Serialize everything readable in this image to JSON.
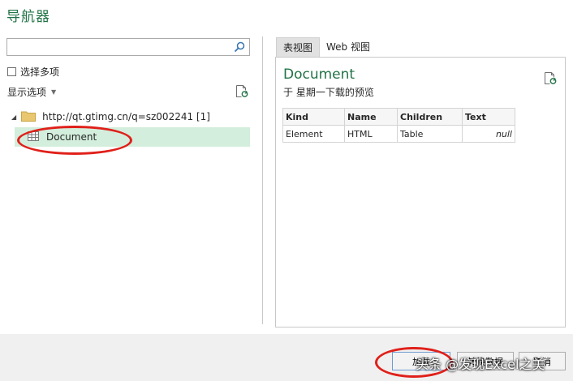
{
  "window": {
    "title": "导航器"
  },
  "left": {
    "search": {
      "value": "",
      "placeholder": ""
    },
    "multi_select_label": "选择多项",
    "display_options_label": "显示选项",
    "tree": {
      "root": {
        "label": "http://qt.gtimg.cn/q=sz002241 [1]"
      },
      "selected": {
        "label": "Document"
      }
    }
  },
  "right": {
    "tabs": [
      {
        "label": "表视图",
        "active": true
      },
      {
        "label": "Web 视图",
        "active": false
      }
    ],
    "preview": {
      "title": "Document",
      "subtitle": "于 星期一下载的预览",
      "columns": [
        "Kind",
        "Name",
        "Children",
        "Text"
      ],
      "rows": [
        [
          "Element",
          "HTML",
          "Table",
          "null"
        ]
      ]
    }
  },
  "footer": {
    "load_label": "加载",
    "transform_label": "转换数据",
    "cancel_label": "取消"
  },
  "watermark": "头条 @发现Excel之美",
  "colors": {
    "accent": "#217346",
    "selected_row": "#d3eedc",
    "annotation": "#e0201a"
  }
}
